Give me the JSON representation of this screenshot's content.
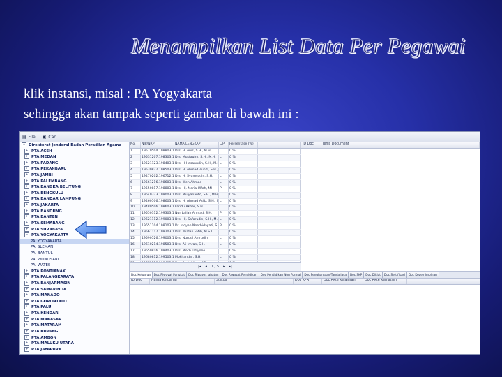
{
  "slide": {
    "title": "Menampilkan List Data Per Pegawai",
    "line1_prefix": "klik instansi, misal : ",
    "line1_emph": "PA Yogyakarta",
    "line2": "sehingga akan tampak seperti gambar di bawah ini :"
  },
  "app": {
    "menu": {
      "file": "File",
      "can": "Can"
    },
    "tree": [
      {
        "label": "Direktorat Jenderal Badan Peradilan Agama",
        "level": "l0",
        "expander": "−"
      },
      {
        "label": "PTA ACEH",
        "level": "l1",
        "expander": "+"
      },
      {
        "label": "PTA MEDAN",
        "level": "l1",
        "expander": "+"
      },
      {
        "label": "PTA PADANG",
        "level": "l1",
        "expander": "+"
      },
      {
        "label": "PTA PEKANBARU",
        "level": "l1",
        "expander": "+"
      },
      {
        "label": "PTA JAMBI",
        "level": "l1",
        "expander": "+"
      },
      {
        "label": "PTA PALEMBANG",
        "level": "l1",
        "expander": "+"
      },
      {
        "label": "PTA BANGKA BELITUNG",
        "level": "l1",
        "expander": "+"
      },
      {
        "label": "PTA BENGKULU",
        "level": "l1",
        "expander": "+"
      },
      {
        "label": "PTA BANDAR LAMPUNG",
        "level": "l1",
        "expander": "+"
      },
      {
        "label": "PTA JAKARTA",
        "level": "l1",
        "expander": "+"
      },
      {
        "label": "PTA BANDUNG",
        "level": "l1",
        "expander": "+"
      },
      {
        "label": "PTA BANTEN",
        "level": "l1",
        "expander": "+"
      },
      {
        "label": "PTA SEMARANG",
        "level": "l1",
        "expander": "+"
      },
      {
        "label": "PTA SURABAYA",
        "level": "l1",
        "expander": "+"
      },
      {
        "label": "PTA YOGYAKARTA",
        "level": "l1",
        "expander": "−"
      },
      {
        "label": "PA. YOGYAKARTA",
        "level": "child",
        "expander": "",
        "selected": true
      },
      {
        "label": "PA. SLEMAN",
        "level": "child",
        "expander": ""
      },
      {
        "label": "PA. BANTUL",
        "level": "child",
        "expander": ""
      },
      {
        "label": "PA. WONOSARI",
        "level": "child",
        "expander": ""
      },
      {
        "label": "PA. WATES",
        "level": "child",
        "expander": ""
      },
      {
        "label": "PTA PONTIANAK",
        "level": "l1",
        "expander": "+"
      },
      {
        "label": "PTA PALANGKARAYA",
        "level": "l1",
        "expander": "+"
      },
      {
        "label": "PTA BANJARMASIN",
        "level": "l1",
        "expander": "+"
      },
      {
        "label": "PTA SAMARINDA",
        "level": "l1",
        "expander": "+"
      },
      {
        "label": "PTA MANADO",
        "level": "l1",
        "expander": "+"
      },
      {
        "label": "PTA GORONTALO",
        "level": "l1",
        "expander": "+"
      },
      {
        "label": "PTA PALU",
        "level": "l1",
        "expander": "+"
      },
      {
        "label": "PTA KENDARI",
        "level": "l1",
        "expander": "+"
      },
      {
        "label": "PTA MAKASAR",
        "level": "l1",
        "expander": "+"
      },
      {
        "label": "PTA MATARAM",
        "level": "l1",
        "expander": "+"
      },
      {
        "label": "PTA KUPANG",
        "level": "l1",
        "expander": "+"
      },
      {
        "label": "PTA AMBON",
        "level": "l1",
        "expander": "+"
      },
      {
        "label": "PTA MALUKU UTARA",
        "level": "l1",
        "expander": "+"
      },
      {
        "label": "PTA JAYAPURA",
        "level": "l1",
        "expander": "+"
      }
    ],
    "grid": {
      "headers": [
        "No.",
        "NIP/NRP",
        "NAMA LENGKAP",
        "L/P",
        "Persentase (%)",
        ""
      ],
      "rows": [
        [
          "1",
          "19570504.198803.1.004",
          "Drs. H. Anis, S.H., M.H.",
          "L",
          "0 %"
        ],
        [
          "2",
          "19531207.198303.1.001",
          "Drs. Mustaqim, S.H., M.H.",
          "L",
          "0 %"
        ],
        [
          "3",
          "19521123.198403.1.001",
          "Drs. H Hasanudin, S.H., M.H.",
          "L",
          "0 %"
        ],
        [
          "4",
          "19530822.198503.1.001",
          "Drs. H. Ahmad Zuhdi, S.H., M.Hum",
          "L",
          "0 %"
        ],
        [
          "5",
          "19470202.196712.1.008",
          "Drs. H. Syamsudin, S.H.",
          "L",
          "0 %"
        ],
        [
          "6",
          "19561216.198603.1.001",
          "Drs. Wen Ahmad",
          "L",
          "0 %"
        ],
        [
          "7",
          "19550817.198803.1.004",
          "Drs. Hj. Maria Ulfah, MH",
          "P",
          "0 %"
        ],
        [
          "8",
          "19640323.199003.1.004",
          "Drs. Mulyananto, S.H., M.H.",
          "L",
          "0 %"
        ],
        [
          "9",
          "19460506.198603.1.005",
          "Drs. H. Ahmad Adib, S.H., M.H.",
          "L",
          "0 %"
        ],
        [
          "10",
          "19480506.198603.1.005",
          "Faridu Akbar, S.H.",
          "L",
          "0 %"
        ],
        [
          "11",
          "19550312.199303.1.004",
          "Nur Lailah Ahmad, S.H.",
          "P",
          "0 %"
        ],
        [
          "12",
          "19621112.199003.1.002",
          "Drs. Hj. Safarudin, S.H., M.Hum",
          "L",
          "0 %"
        ],
        [
          "13",
          "19651104.198103.1.003",
          "Dr. Indyah Noerhidayati, S.H., M.Pd",
          "P",
          "0 %"
        ],
        [
          "14",
          "19561117.199203.1.003",
          "Drs. Wildan Fatih, M.S.I.",
          "L",
          "0 %"
        ],
        [
          "15",
          "19590526.199003.1.002",
          "Drs. Nurudi Amrudin",
          "L",
          "0 %"
        ],
        [
          "16",
          "19610214.198503.1.003",
          "Drs. Ali Imran, S.H.",
          "L",
          "0 %"
        ],
        [
          "17",
          "19650816.199403.1.003",
          "Drs. Moch Udiyono",
          "L",
          "0 %"
        ],
        [
          "18",
          "19680812.199503.1.001",
          "Mokhandar, S.H.",
          "L",
          "0 %"
        ],
        [
          "19",
          "19671228.199403.1.004",
          "Drs. Abdul Azim AT",
          "L",
          "0 %"
        ],
        [
          "20",
          "19670703.199203.1.001",
          "Dallas Farid, S.H., M.H.",
          "L",
          "0 %"
        ]
      ],
      "pager": "1 / 5"
    },
    "docs_headers": [
      "ID Doc",
      "Jenis Document"
    ],
    "tabs": [
      "Doc Keluarga",
      "Doc Riwayat Pangkat",
      "Doc Riwayat Jabatan",
      "Doc Riwayat Pendidikan",
      "Doc Pendidikan Non Formal",
      "Doc Penghargaan/Tanda Jasa",
      "Doc SKP",
      "Doc Diklat",
      "Doc Sertifikasi",
      "Doc Kepemimpinan"
    ],
    "bottom_headers": [
      "ID Doc",
      "Nama Keluarga",
      "Status",
      "Doc KPR",
      "Doc Akte Kelahiran",
      "Doc Akte Kematian"
    ]
  }
}
